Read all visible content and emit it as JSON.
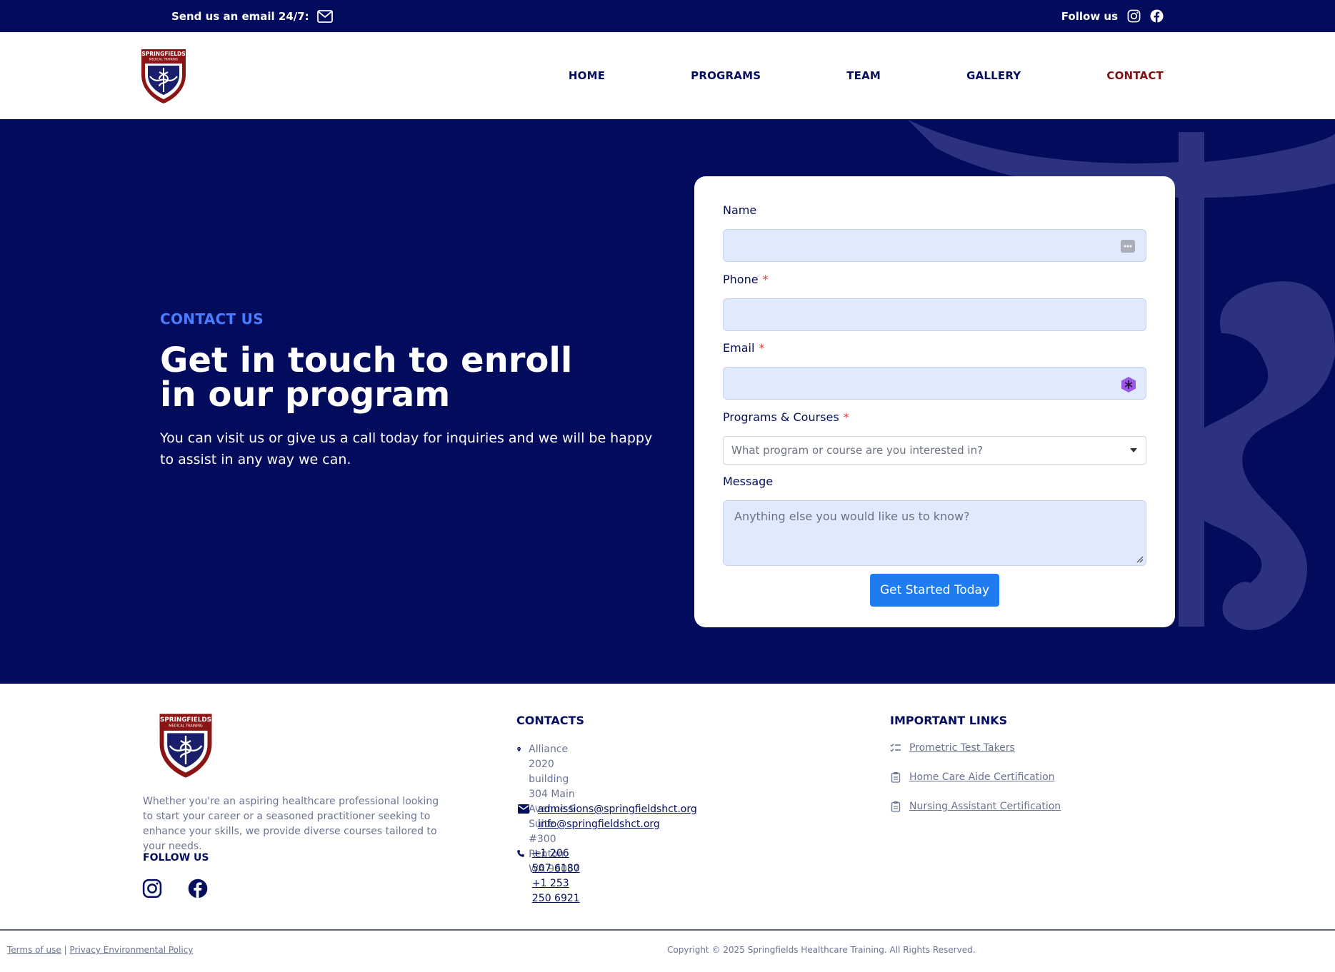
{
  "topbar": {
    "email_cta": "Send us an email 24/7:",
    "follow_label": "Follow us"
  },
  "header": {
    "logo_text": "SPRINGFIELDS MEDICAL TRAINING",
    "nav": [
      {
        "label": "HOME"
      },
      {
        "label": "PROGRAMS"
      },
      {
        "label": "TEAM"
      },
      {
        "label": "GALLERY"
      },
      {
        "label": "CONTACT",
        "active": true
      }
    ]
  },
  "hero": {
    "eyebrow": "CONTACT US",
    "title": "Get in touch to enroll in our program",
    "subtitle": "You can visit us or give us a call today for inquiries and we will be happy to assist in any way we can."
  },
  "form": {
    "name_label": "Name",
    "phone_label": "Phone",
    "email_label": "Email",
    "programs_label": "Programs & Courses",
    "programs_placeholder": "What program or course are you interested in?",
    "message_label": "Message",
    "message_placeholder": "Anything else you would like us to know?",
    "required_mark": "*",
    "submit_label": "Get Started Today"
  },
  "footer": {
    "about": "Whether you're an aspiring healthcare professional looking to start your career or a seasoned practitioner seeking to enhance your skills, we provide diverse courses tailored to your needs.",
    "follow_title": "FOLLOW US",
    "contacts_title": "CONTACTS",
    "address": [
      "Alliance 2020 building",
      "304 Main Avenue S Suite #300",
      "Renton, WA  98057"
    ],
    "emails": [
      "admissions@springfieldshct.org",
      "info@springfieldshct.org"
    ],
    "phones": [
      "+1 206 507 6180",
      "+1 253 250 6921"
    ],
    "links_title": "IMPORTANT LINKS",
    "links": [
      "Prometric Test Takers",
      "Home Care Aide Certification",
      "Nursing Assistant Certification"
    ]
  },
  "bottom": {
    "terms": "Terms of use",
    "separator": "|",
    "privacy": "Privacy Environmental Policy",
    "copyright": "Copyright © 2025 Springfields Healthcare Training. All Rights Reserved."
  },
  "colors": {
    "navy": "#020b5c",
    "accent_red": "#7a1212",
    "eyebrow_blue": "#4a7dff",
    "button_blue": "#1e7cf0",
    "input_bg": "#e1e9fc"
  }
}
